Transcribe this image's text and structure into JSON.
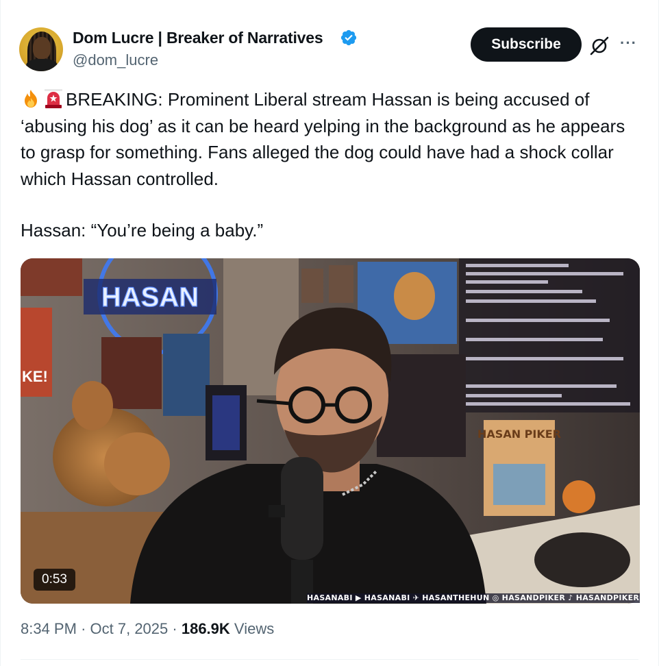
{
  "author": {
    "display_name": "Dom Lucre | Breaker of Narratives",
    "handle": "@dom_lucre",
    "verified_color": "#1d9bf0"
  },
  "actions": {
    "subscribe_label": "Subscribe",
    "grok_icon": "grok-slash-icon",
    "more_icon": "more-dots-icon"
  },
  "tweet": {
    "emoji_1": "fire-emoji",
    "emoji_2": "siren-emoji",
    "body": "BREAKING: Prominent Liberal stream Hassan is being accused of ‘abusing his dog’ as it can be heard yelping in the background as he appears to grasp for something. Fans alleged the dog could have had a shock collar which Hassan controlled.",
    "quote": "Hassan: “You’re being a baby.”"
  },
  "media": {
    "duration": "0:53",
    "neon_sign": "HASAN",
    "social_strip": "HASANABI ▶ HASANABI ✈ HASANTHEHUN ◎ HASANDPIKER ♪ HASANDPIKER"
  },
  "meta": {
    "time": "8:34 PM",
    "separator": "·",
    "date": "Oct 7, 2025",
    "views_count": "186.9K",
    "views_label": "Views"
  },
  "colors": {
    "text": "#0f1419",
    "muted": "#536471",
    "border": "#eff3f4",
    "brand": "#1d9bf0"
  }
}
